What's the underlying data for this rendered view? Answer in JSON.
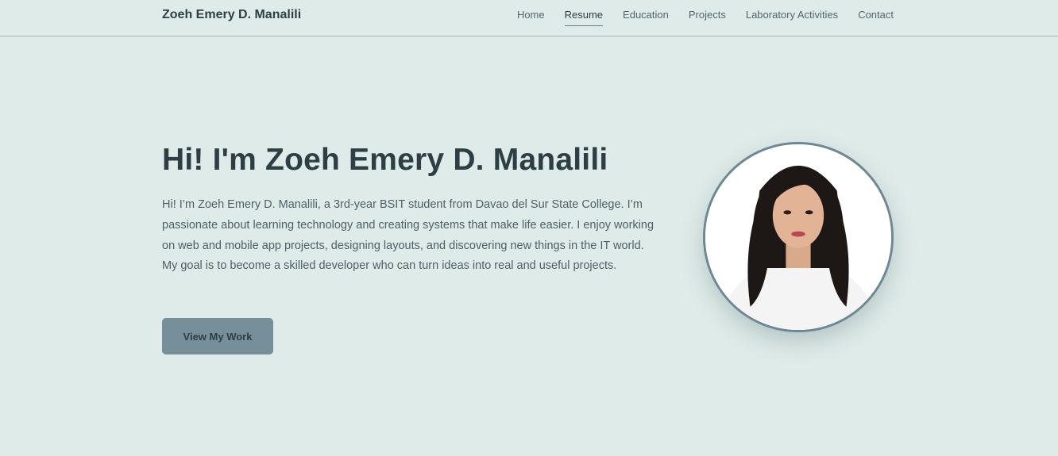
{
  "header": {
    "brand": "Zoeh Emery D. Manalili",
    "nav": [
      {
        "label": "Home"
      },
      {
        "label": "Resume"
      },
      {
        "label": "Education"
      },
      {
        "label": "Projects"
      },
      {
        "label": "Laboratory Activities"
      },
      {
        "label": "Contact"
      }
    ],
    "active_nav": "Resume"
  },
  "hero": {
    "title": "Hi! I'm Zoeh Emery D. Manalili",
    "intro": "Hi! I’m Zoeh Emery D. Manalili, a 3rd-year BSIT student from Davao del Sur State College. I’m passionate about learning technology and creating systems that make life easier. I enjoy working on web and mobile app projects, designing layouts, and discovering new things in the IT world. My goal is to become a skilled developer who can turn ideas into real and useful projects.",
    "cta_label": "View My Work"
  },
  "colors": {
    "background": "#dfebe8",
    "text_dark": "#2d3e45",
    "button": "#778e9b",
    "avatar_border": "#6d8794"
  }
}
